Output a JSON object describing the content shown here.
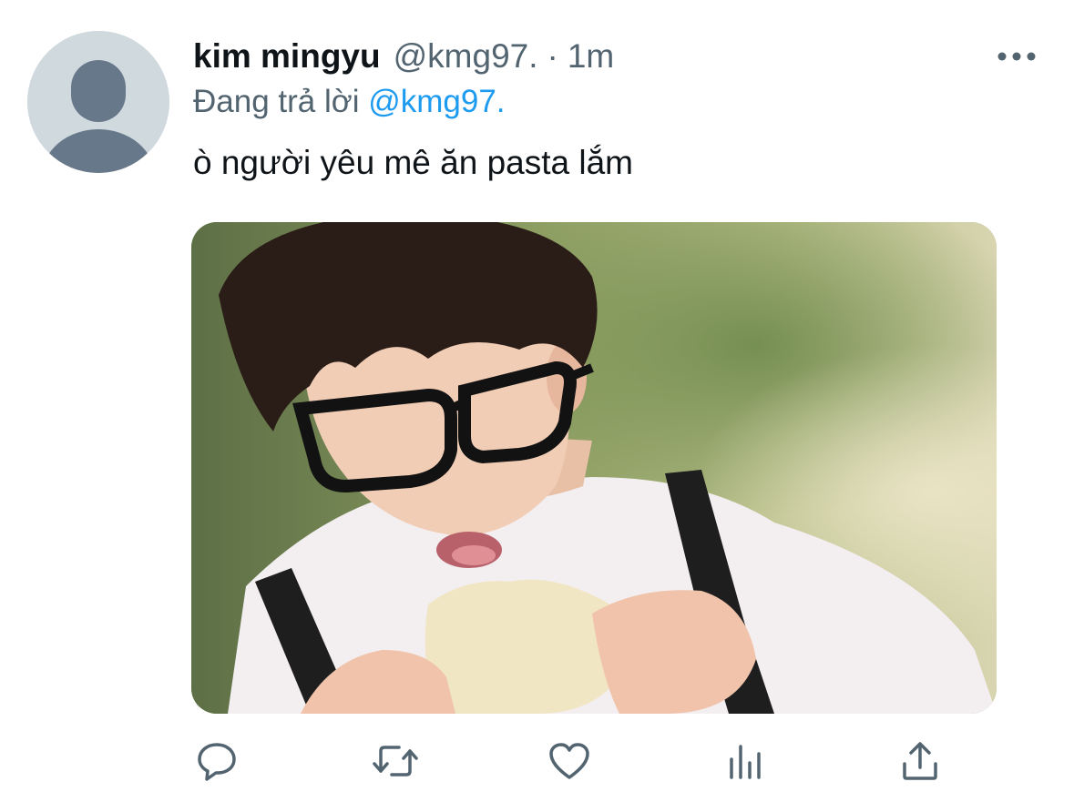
{
  "tweet": {
    "display_name": "kim mingyu",
    "handle": "@kmg97.",
    "separator": "·",
    "time": "1m",
    "reply_prefix": "Đang trả lời",
    "reply_to": "@kmg97.",
    "text": "ò người yêu mê ăn pasta lắm"
  },
  "icons": {
    "more": "more-horizontal-icon",
    "reply": "comment-icon",
    "retweet": "retweet-icon",
    "like": "heart-icon",
    "analytics": "bar-chart-icon",
    "share": "share-icon"
  },
  "colors": {
    "text_primary": "#0f1419",
    "text_secondary": "#536471",
    "accent": "#1d9bf0",
    "avatar_bg": "#cfd9de",
    "avatar_fg": "#66788a"
  }
}
